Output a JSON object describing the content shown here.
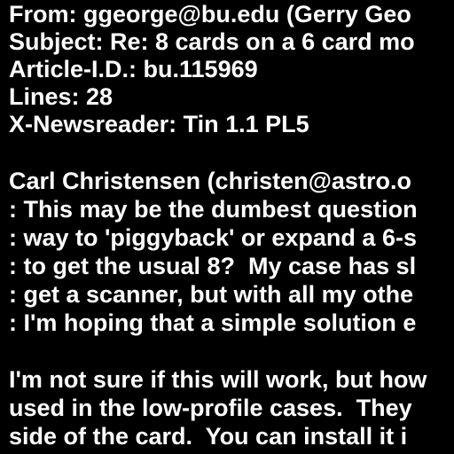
{
  "text_color": "#ffffff",
  "background_color": "#000000",
  "header": {
    "from": "From: ggeorge@bu.edu (Gerry Geo",
    "subject": "Subject: Re: 8 cards on a 6 card mo",
    "article_id": "Article-I.D.: bu.115969",
    "lines": "Lines: 28",
    "newsreader": "X-Newsreader: Tin 1.1 PL5"
  },
  "quoted": {
    "attribution": "Carl Christensen (christen@astro.o",
    "lines": [
      ": This may be the dumbest question",
      ": way to 'piggyback' or expand a 6-s",
      ": to get the usual 8?  My case has sl",
      ": get a scanner, but with all my othe",
      ": I'm hoping that a simple solution e"
    ]
  },
  "reply": {
    "lines": [
      "I'm not sure if this will work, but how",
      "used in the low-profile cases.  They",
      "side of the card.  You can install it i"
    ]
  }
}
